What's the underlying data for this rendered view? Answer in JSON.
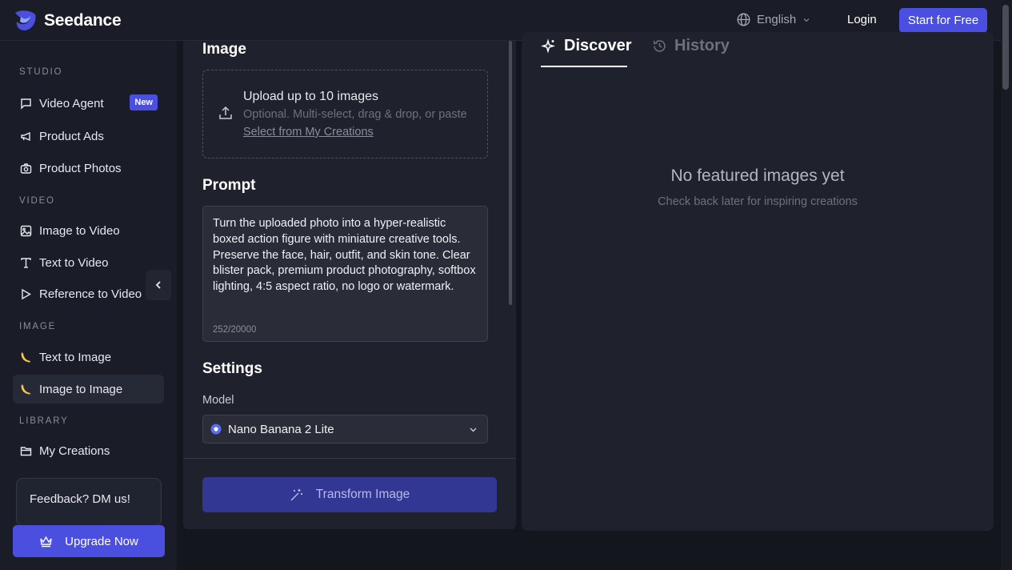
{
  "header": {
    "brand": "Seedance",
    "language": "English",
    "login": "Login",
    "start": "Start for Free"
  },
  "sidebar": {
    "sections": [
      "STUDIO",
      "VIDEO",
      "IMAGE",
      "LIBRARY"
    ],
    "items": [
      {
        "label": "Video Agent",
        "icon": "chat-icon",
        "badge": "New"
      },
      {
        "label": "Product Ads",
        "icon": "megaphone-icon"
      },
      {
        "label": "Product Photos",
        "icon": "camera-icon"
      },
      {
        "label": "Image to Video",
        "icon": "image-icon"
      },
      {
        "label": "Text to Video",
        "icon": "text-icon"
      },
      {
        "label": "Reference to Video",
        "icon": "play-icon"
      },
      {
        "label": "Text to Image",
        "icon": "banana-icon"
      },
      {
        "label": "Image to Image",
        "icon": "banana-icon",
        "active": true
      },
      {
        "label": "My Creations",
        "icon": "folder-icon"
      }
    ],
    "feedback": "Feedback? DM us!",
    "upgrade": "Upgrade Now"
  },
  "form": {
    "image_heading": "Image",
    "upload_title": "Upload up to 10 images",
    "upload_hint": "Optional. Multi-select, drag & drop, or paste",
    "upload_link": "Select from My Creations",
    "prompt_heading": "Prompt",
    "prompt_text": "Turn the uploaded photo into a hyper-realistic boxed action figure with miniature creative tools. Preserve the face, hair, outfit, and skin tone. Clear blister pack, premium product photography, softbox lighting, 4:5 aspect ratio, no logo or watermark.",
    "char_count": "252/20000",
    "settings_heading": "Settings",
    "model_label": "Model",
    "model_value": "Nano Banana 2 Lite",
    "submit": "Transform Image"
  },
  "gallery": {
    "tabs": [
      {
        "label": "Discover",
        "active": true
      },
      {
        "label": "History",
        "active": false
      }
    ],
    "empty_title": "No featured images yet",
    "empty_subtitle": "Check back later for inspiring creations"
  },
  "colors": {
    "accent": "#4b4fe0",
    "background": "#14161e",
    "panel": "#1f222d"
  }
}
